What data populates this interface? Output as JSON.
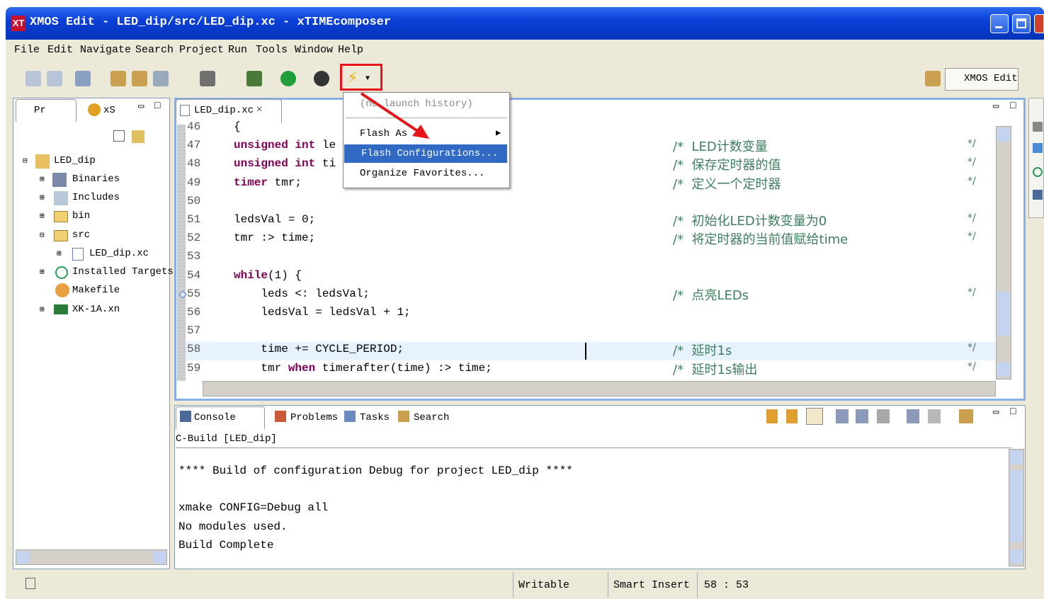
{
  "window": {
    "title": "XMOS Edit - LED_dip/src/LED_dip.xc - xTIMEcomposer",
    "app_icon": "XT"
  },
  "menubar": [
    "File",
    "Edit",
    "Navigate",
    "Search",
    "Project",
    "Run",
    "Tools",
    "Window",
    "Help"
  ],
  "perspective": {
    "label": "XMOS Edit"
  },
  "left_panel": {
    "tabs": [
      "Pr",
      "xS"
    ],
    "tree": [
      {
        "label": "LED_dip",
        "icon": "project-icon"
      },
      {
        "label": "Binaries",
        "icon": "binaries-icon"
      },
      {
        "label": "Includes",
        "icon": "includes-icon"
      },
      {
        "label": "bin",
        "icon": "folder-icon"
      },
      {
        "label": "src",
        "icon": "folder-icon"
      },
      {
        "label": "LED_dip.xc",
        "icon": "xc-file-icon"
      },
      {
        "label": "Installed Targets",
        "icon": "target-icon"
      },
      {
        "label": "Makefile",
        "icon": "makefile-icon"
      },
      {
        "label": "XK-1A.xn",
        "icon": "board-icon"
      }
    ]
  },
  "editor": {
    "tab": "LED_dip.xc",
    "lines": [
      {
        "n": "46",
        "code": "{",
        "comment": ""
      },
      {
        "n": "47",
        "code": "unsigned int le",
        "comment": "/*  LED计数变量"
      },
      {
        "n": "48",
        "code": "unsigned int ti",
        "comment": "/*  保存定时器的值"
      },
      {
        "n": "49",
        "code": "timer tmr;",
        "comment": "/*  定义一个定时器"
      },
      {
        "n": "50",
        "code": "",
        "comment": ""
      },
      {
        "n": "51",
        "code": "ledsVal = 0;",
        "comment": "/*  初始化LED计数变量为0"
      },
      {
        "n": "52",
        "code": "tmr :> time;",
        "comment": "/*  将定时器的当前值赋给time"
      },
      {
        "n": "53",
        "code": "",
        "comment": ""
      },
      {
        "n": "54",
        "code": "while(1) {",
        "comment": ""
      },
      {
        "n": "55",
        "code": "    leds <: ledsVal;",
        "comment": "/*  点亮LEDs"
      },
      {
        "n": "56",
        "code": "    ledsVal = ledsVal + 1;",
        "comment": ""
      },
      {
        "n": "57",
        "code": "",
        "comment": ""
      },
      {
        "n": "58",
        "code": "    time += CYCLE_PERIOD;",
        "comment": "/*  延时1s"
      },
      {
        "n": "59",
        "code": "    tmr when timerafter(time) :> time;",
        "comment": "/*  延时1s输出"
      }
    ],
    "comment_end": "*/"
  },
  "dropdown": {
    "items": [
      "(no launch history)",
      "Flash As",
      "Flash Configurations...",
      "Organize Favorites..."
    ],
    "selected": "Flash Configurations..."
  },
  "bottom_panel": {
    "tabs": [
      "Console",
      "Problems",
      "Tasks",
      "Search"
    ],
    "console_title": "C-Build [LED_dip]",
    "console_lines": [
      "**** Build of configuration Debug for project LED_dip ****",
      "",
      "xmake CONFIG=Debug all",
      "No modules used.",
      "Build Complete"
    ]
  },
  "statusbar": {
    "mode": "Writable",
    "insert": "Smart Insert",
    "position": "58 : 53"
  },
  "colors": {
    "highlight": "#e8f2fe",
    "selection": "#316ac5",
    "red_box": "#e8141b",
    "title_bar": "#0a3fd8"
  }
}
